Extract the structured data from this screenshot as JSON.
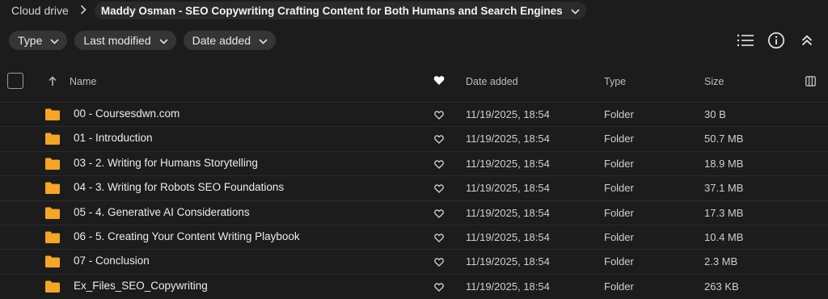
{
  "breadcrumb": {
    "root": "Cloud drive",
    "current": "Maddy Osman - SEO Copywriting Crafting Content for Both Humans and Search Engines"
  },
  "filters": [
    {
      "label": "Type"
    },
    {
      "label": "Last modified"
    },
    {
      "label": "Date added"
    }
  ],
  "toolbar": {
    "icons": [
      "list-view-icon",
      "info-icon",
      "collapse-icon"
    ]
  },
  "table": {
    "headers": {
      "name": "Name",
      "date_added": "Date added",
      "type": "Type",
      "size": "Size"
    },
    "rows": [
      {
        "name": "00 - Coursesdwn.com",
        "date": "11/19/2025, 18:54",
        "type": "Folder",
        "size": "30 B"
      },
      {
        "name": "01 - Introduction",
        "date": "11/19/2025, 18:54",
        "type": "Folder",
        "size": "50.7 MB"
      },
      {
        "name": "03 - 2. Writing for Humans Storytelling",
        "date": "11/19/2025, 18:54",
        "type": "Folder",
        "size": "18.9 MB"
      },
      {
        "name": "04 - 3. Writing for Robots SEO Foundations",
        "date": "11/19/2025, 18:54",
        "type": "Folder",
        "size": "37.1 MB"
      },
      {
        "name": "05 - 4. Generative AI Considerations",
        "date": "11/19/2025, 18:54",
        "type": "Folder",
        "size": "17.3 MB"
      },
      {
        "name": "06 - 5. Creating Your Content Writing Playbook",
        "date": "11/19/2025, 18:54",
        "type": "Folder",
        "size": "10.4 MB"
      },
      {
        "name": "07 - Conclusion",
        "date": "11/19/2025, 18:54",
        "type": "Folder",
        "size": "2.3 MB"
      },
      {
        "name": "Ex_Files_SEO_Copywriting",
        "date": "11/19/2025, 18:54",
        "type": "Folder",
        "size": "263 KB"
      }
    ]
  },
  "colors": {
    "background": "#1c1c1c",
    "chip": "#353535",
    "folder": "#f5a623"
  }
}
